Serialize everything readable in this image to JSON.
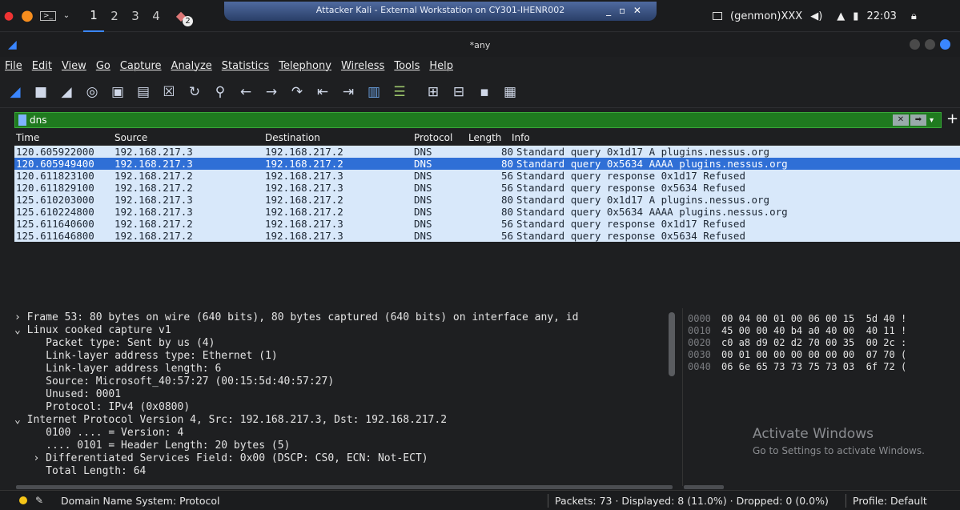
{
  "taskbar": {
    "workspaces": [
      "1",
      "2",
      "3",
      "4"
    ],
    "active_workspace": "1",
    "notification_badge": "2",
    "vm_title": "Attacker Kali - External Workstation on CY301-IHENR002",
    "genmon": "(genmon)XXX",
    "clock": "22:03"
  },
  "window": {
    "title": "*any"
  },
  "menu": [
    "File",
    "Edit",
    "View",
    "Go",
    "Capture",
    "Analyze",
    "Statistics",
    "Telephony",
    "Wireless",
    "Tools",
    "Help"
  ],
  "filter": {
    "value": "dns"
  },
  "columns": [
    "Time",
    "Source",
    "Destination",
    "Protocol",
    "Length",
    "Info"
  ],
  "packets": [
    {
      "time": "120.605922000",
      "src": "192.168.217.3",
      "dst": "192.168.217.2",
      "proto": "DNS",
      "len": "80",
      "info": "Standard query 0x1d17 A plugins.nessus.org",
      "selected": false
    },
    {
      "time": "120.605949400",
      "src": "192.168.217.3",
      "dst": "192.168.217.2",
      "proto": "DNS",
      "len": "80",
      "info": "Standard query 0x5634 AAAA plugins.nessus.org",
      "selected": true
    },
    {
      "time": "120.611823100",
      "src": "192.168.217.2",
      "dst": "192.168.217.3",
      "proto": "DNS",
      "len": "56",
      "info": "Standard query response 0x1d17 Refused",
      "selected": false
    },
    {
      "time": "120.611829100",
      "src": "192.168.217.2",
      "dst": "192.168.217.3",
      "proto": "DNS",
      "len": "56",
      "info": "Standard query response 0x5634 Refused",
      "selected": false
    },
    {
      "time": "125.610203000",
      "src": "192.168.217.3",
      "dst": "192.168.217.2",
      "proto": "DNS",
      "len": "80",
      "info": "Standard query 0x1d17 A plugins.nessus.org",
      "selected": false
    },
    {
      "time": "125.610224800",
      "src": "192.168.217.3",
      "dst": "192.168.217.2",
      "proto": "DNS",
      "len": "80",
      "info": "Standard query 0x5634 AAAA plugins.nessus.org",
      "selected": false
    },
    {
      "time": "125.611640600",
      "src": "192.168.217.2",
      "dst": "192.168.217.3",
      "proto": "DNS",
      "len": "56",
      "info": "Standard query response 0x1d17 Refused",
      "selected": false
    },
    {
      "time": "125.611646800",
      "src": "192.168.217.2",
      "dst": "192.168.217.3",
      "proto": "DNS",
      "len": "56",
      "info": "Standard query response 0x5634 Refused",
      "selected": false
    }
  ],
  "details": [
    "› Frame 53: 80 bytes on wire (640 bits), 80 bytes captured (640 bits) on interface any, id",
    "⌄ Linux cooked capture v1",
    "     Packet type: Sent by us (4)",
    "     Link-layer address type: Ethernet (1)",
    "     Link-layer address length: 6",
    "     Source: Microsoft_40:57:27 (00:15:5d:40:57:27)",
    "     Unused: 0001",
    "     Protocol: IPv4 (0x0800)",
    "⌄ Internet Protocol Version 4, Src: 192.168.217.3, Dst: 192.168.217.2",
    "     0100 .... = Version: 4",
    "     .... 0101 = Header Length: 20 bytes (5)",
    "   › Differentiated Services Field: 0x00 (DSCP: CS0, ECN: Not-ECT)",
    "     Total Length: 64"
  ],
  "hex": [
    {
      "off": "0000",
      "bytes": "00 04 00 01 00 06 00 15  5d 40 !"
    },
    {
      "off": "0010",
      "bytes": "45 00 00 40 b4 a0 40 00  40 11 !"
    },
    {
      "off": "0020",
      "bytes": "c0 a8 d9 02 d2 70 00 35  00 2c :"
    },
    {
      "off": "0030",
      "bytes": "00 01 00 00 00 00 00 00  07 70 ("
    },
    {
      "off": "0040",
      "bytes": "06 6e 65 73 73 75 73 03  6f 72 ("
    }
  ],
  "watermark": {
    "line1": "Activate Windows",
    "line2": "Go to Settings to activate Windows."
  },
  "status": {
    "protocol": "Domain Name System: Protocol",
    "counts": "Packets: 73 · Displayed: 8 (11.0%) · Dropped: 0 (0.0%)",
    "profile": "Profile: Default"
  }
}
